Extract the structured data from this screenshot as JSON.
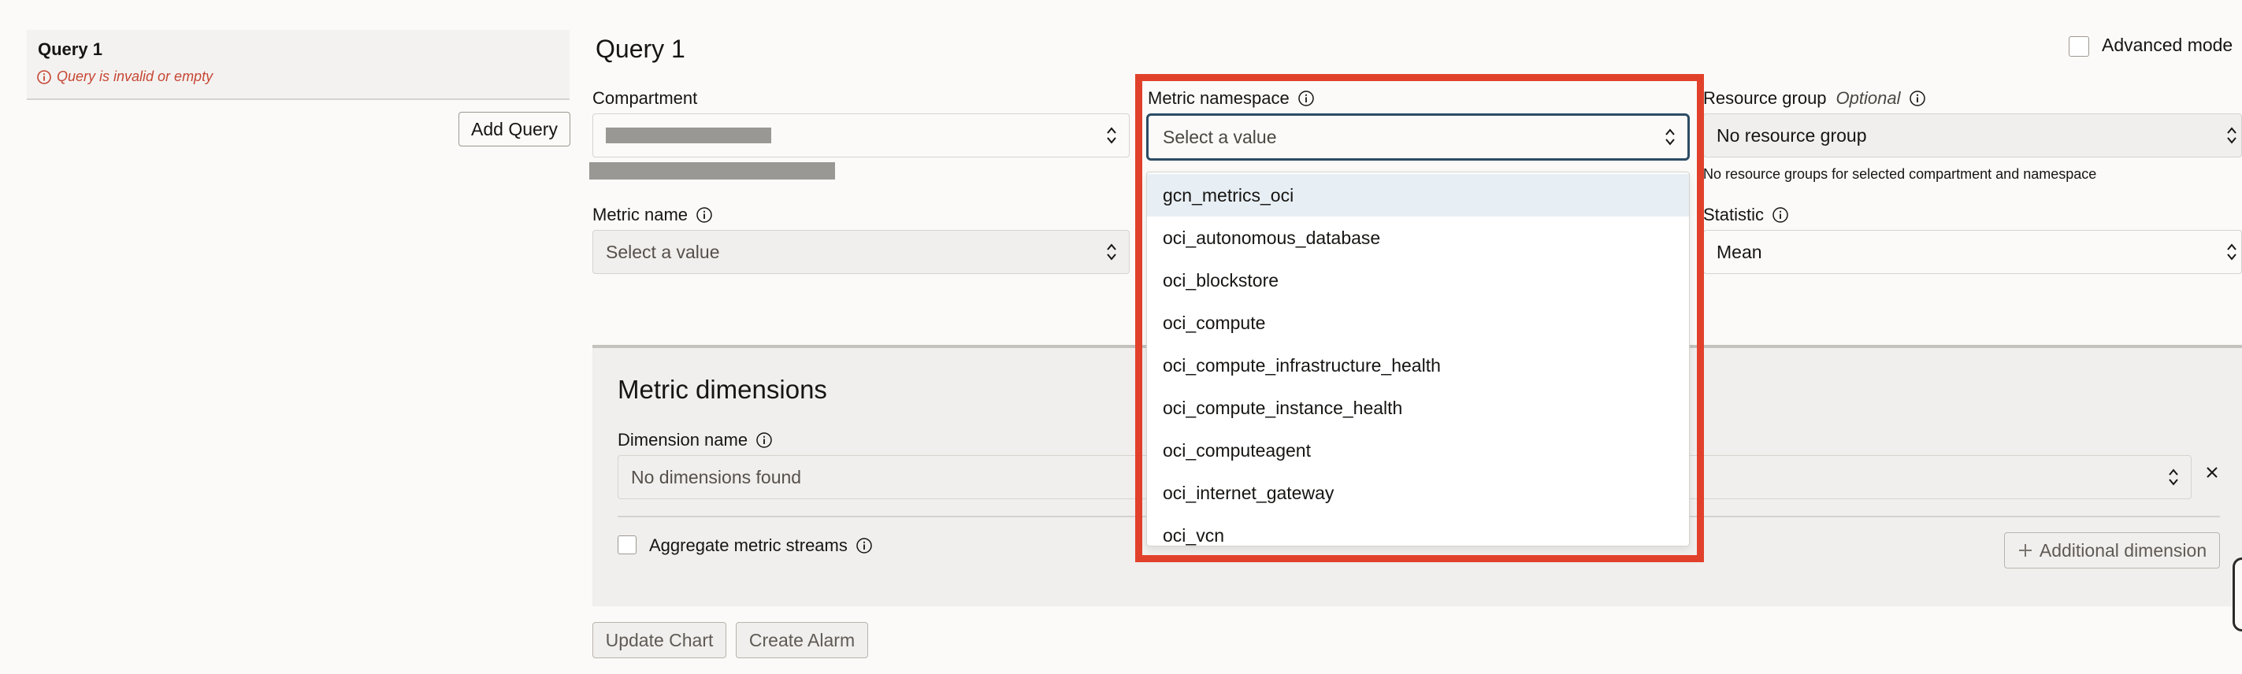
{
  "sidebar": {
    "query_title": "Query 1",
    "error_text": "Query is invalid or empty",
    "add_query_label": "Add Query"
  },
  "main": {
    "heading": "Query 1",
    "advanced_mode_label": "Advanced mode",
    "advanced_mode_checked": false,
    "compartment": {
      "label": "Compartment",
      "value": ""
    },
    "metric_namespace": {
      "label": "Metric namespace",
      "placeholder": "Select a value",
      "options": [
        "gcn_metrics_oci",
        "oci_autonomous_database",
        "oci_blockstore",
        "oci_compute",
        "oci_compute_infrastructure_health",
        "oci_compute_instance_health",
        "oci_computeagent",
        "oci_internet_gateway",
        "oci_vcn"
      ],
      "active_option_index": 0
    },
    "resource_group": {
      "label": "Resource group",
      "optional_label": "Optional",
      "value": "No resource group",
      "helper": "No resource groups for selected compartment and namespace"
    },
    "metric_name": {
      "label": "Metric name",
      "placeholder": "Select a value"
    },
    "statistic": {
      "label": "Statistic",
      "value": "Mean"
    }
  },
  "dimensions": {
    "title": "Metric dimensions",
    "dimension_name_label": "Dimension name",
    "dimension_name_value": "No dimensions found",
    "aggregate_label": "Aggregate metric streams",
    "additional_dimension_label": "Additional dimension"
  },
  "actions": {
    "update_chart_label": "Update Chart",
    "create_alarm_label": "Create Alarm"
  },
  "colors": {
    "highlight": "#e1412b",
    "error": "#c74634",
    "focus_border": "#2c4b63",
    "active_option": "#e8eff4"
  }
}
